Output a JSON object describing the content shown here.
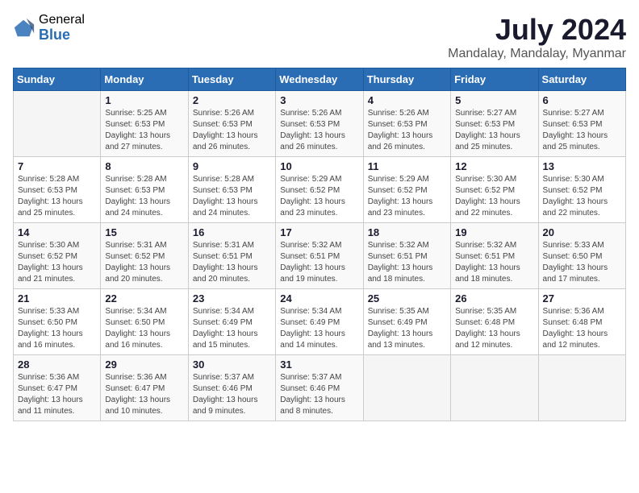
{
  "header": {
    "logo_general": "General",
    "logo_blue": "Blue",
    "title": "July 2024",
    "location": "Mandalay, Mandalay, Myanmar"
  },
  "weekdays": [
    "Sunday",
    "Monday",
    "Tuesday",
    "Wednesday",
    "Thursday",
    "Friday",
    "Saturday"
  ],
  "weeks": [
    [
      {
        "day": "",
        "info": ""
      },
      {
        "day": "1",
        "info": "Sunrise: 5:25 AM\nSunset: 6:53 PM\nDaylight: 13 hours\nand 27 minutes."
      },
      {
        "day": "2",
        "info": "Sunrise: 5:26 AM\nSunset: 6:53 PM\nDaylight: 13 hours\nand 26 minutes."
      },
      {
        "day": "3",
        "info": "Sunrise: 5:26 AM\nSunset: 6:53 PM\nDaylight: 13 hours\nand 26 minutes."
      },
      {
        "day": "4",
        "info": "Sunrise: 5:26 AM\nSunset: 6:53 PM\nDaylight: 13 hours\nand 26 minutes."
      },
      {
        "day": "5",
        "info": "Sunrise: 5:27 AM\nSunset: 6:53 PM\nDaylight: 13 hours\nand 25 minutes."
      },
      {
        "day": "6",
        "info": "Sunrise: 5:27 AM\nSunset: 6:53 PM\nDaylight: 13 hours\nand 25 minutes."
      }
    ],
    [
      {
        "day": "7",
        "info": "Sunrise: 5:28 AM\nSunset: 6:53 PM\nDaylight: 13 hours\nand 25 minutes."
      },
      {
        "day": "8",
        "info": "Sunrise: 5:28 AM\nSunset: 6:53 PM\nDaylight: 13 hours\nand 24 minutes."
      },
      {
        "day": "9",
        "info": "Sunrise: 5:28 AM\nSunset: 6:53 PM\nDaylight: 13 hours\nand 24 minutes."
      },
      {
        "day": "10",
        "info": "Sunrise: 5:29 AM\nSunset: 6:52 PM\nDaylight: 13 hours\nand 23 minutes."
      },
      {
        "day": "11",
        "info": "Sunrise: 5:29 AM\nSunset: 6:52 PM\nDaylight: 13 hours\nand 23 minutes."
      },
      {
        "day": "12",
        "info": "Sunrise: 5:30 AM\nSunset: 6:52 PM\nDaylight: 13 hours\nand 22 minutes."
      },
      {
        "day": "13",
        "info": "Sunrise: 5:30 AM\nSunset: 6:52 PM\nDaylight: 13 hours\nand 22 minutes."
      }
    ],
    [
      {
        "day": "14",
        "info": "Sunrise: 5:30 AM\nSunset: 6:52 PM\nDaylight: 13 hours\nand 21 minutes."
      },
      {
        "day": "15",
        "info": "Sunrise: 5:31 AM\nSunset: 6:52 PM\nDaylight: 13 hours\nand 20 minutes."
      },
      {
        "day": "16",
        "info": "Sunrise: 5:31 AM\nSunset: 6:51 PM\nDaylight: 13 hours\nand 20 minutes."
      },
      {
        "day": "17",
        "info": "Sunrise: 5:32 AM\nSunset: 6:51 PM\nDaylight: 13 hours\nand 19 minutes."
      },
      {
        "day": "18",
        "info": "Sunrise: 5:32 AM\nSunset: 6:51 PM\nDaylight: 13 hours\nand 18 minutes."
      },
      {
        "day": "19",
        "info": "Sunrise: 5:32 AM\nSunset: 6:51 PM\nDaylight: 13 hours\nand 18 minutes."
      },
      {
        "day": "20",
        "info": "Sunrise: 5:33 AM\nSunset: 6:50 PM\nDaylight: 13 hours\nand 17 minutes."
      }
    ],
    [
      {
        "day": "21",
        "info": "Sunrise: 5:33 AM\nSunset: 6:50 PM\nDaylight: 13 hours\nand 16 minutes."
      },
      {
        "day": "22",
        "info": "Sunrise: 5:34 AM\nSunset: 6:50 PM\nDaylight: 13 hours\nand 16 minutes."
      },
      {
        "day": "23",
        "info": "Sunrise: 5:34 AM\nSunset: 6:49 PM\nDaylight: 13 hours\nand 15 minutes."
      },
      {
        "day": "24",
        "info": "Sunrise: 5:34 AM\nSunset: 6:49 PM\nDaylight: 13 hours\nand 14 minutes."
      },
      {
        "day": "25",
        "info": "Sunrise: 5:35 AM\nSunset: 6:49 PM\nDaylight: 13 hours\nand 13 minutes."
      },
      {
        "day": "26",
        "info": "Sunrise: 5:35 AM\nSunset: 6:48 PM\nDaylight: 13 hours\nand 12 minutes."
      },
      {
        "day": "27",
        "info": "Sunrise: 5:36 AM\nSunset: 6:48 PM\nDaylight: 13 hours\nand 12 minutes."
      }
    ],
    [
      {
        "day": "28",
        "info": "Sunrise: 5:36 AM\nSunset: 6:47 PM\nDaylight: 13 hours\nand 11 minutes."
      },
      {
        "day": "29",
        "info": "Sunrise: 5:36 AM\nSunset: 6:47 PM\nDaylight: 13 hours\nand 10 minutes."
      },
      {
        "day": "30",
        "info": "Sunrise: 5:37 AM\nSunset: 6:46 PM\nDaylight: 13 hours\nand 9 minutes."
      },
      {
        "day": "31",
        "info": "Sunrise: 5:37 AM\nSunset: 6:46 PM\nDaylight: 13 hours\nand 8 minutes."
      },
      {
        "day": "",
        "info": ""
      },
      {
        "day": "",
        "info": ""
      },
      {
        "day": "",
        "info": ""
      }
    ]
  ]
}
